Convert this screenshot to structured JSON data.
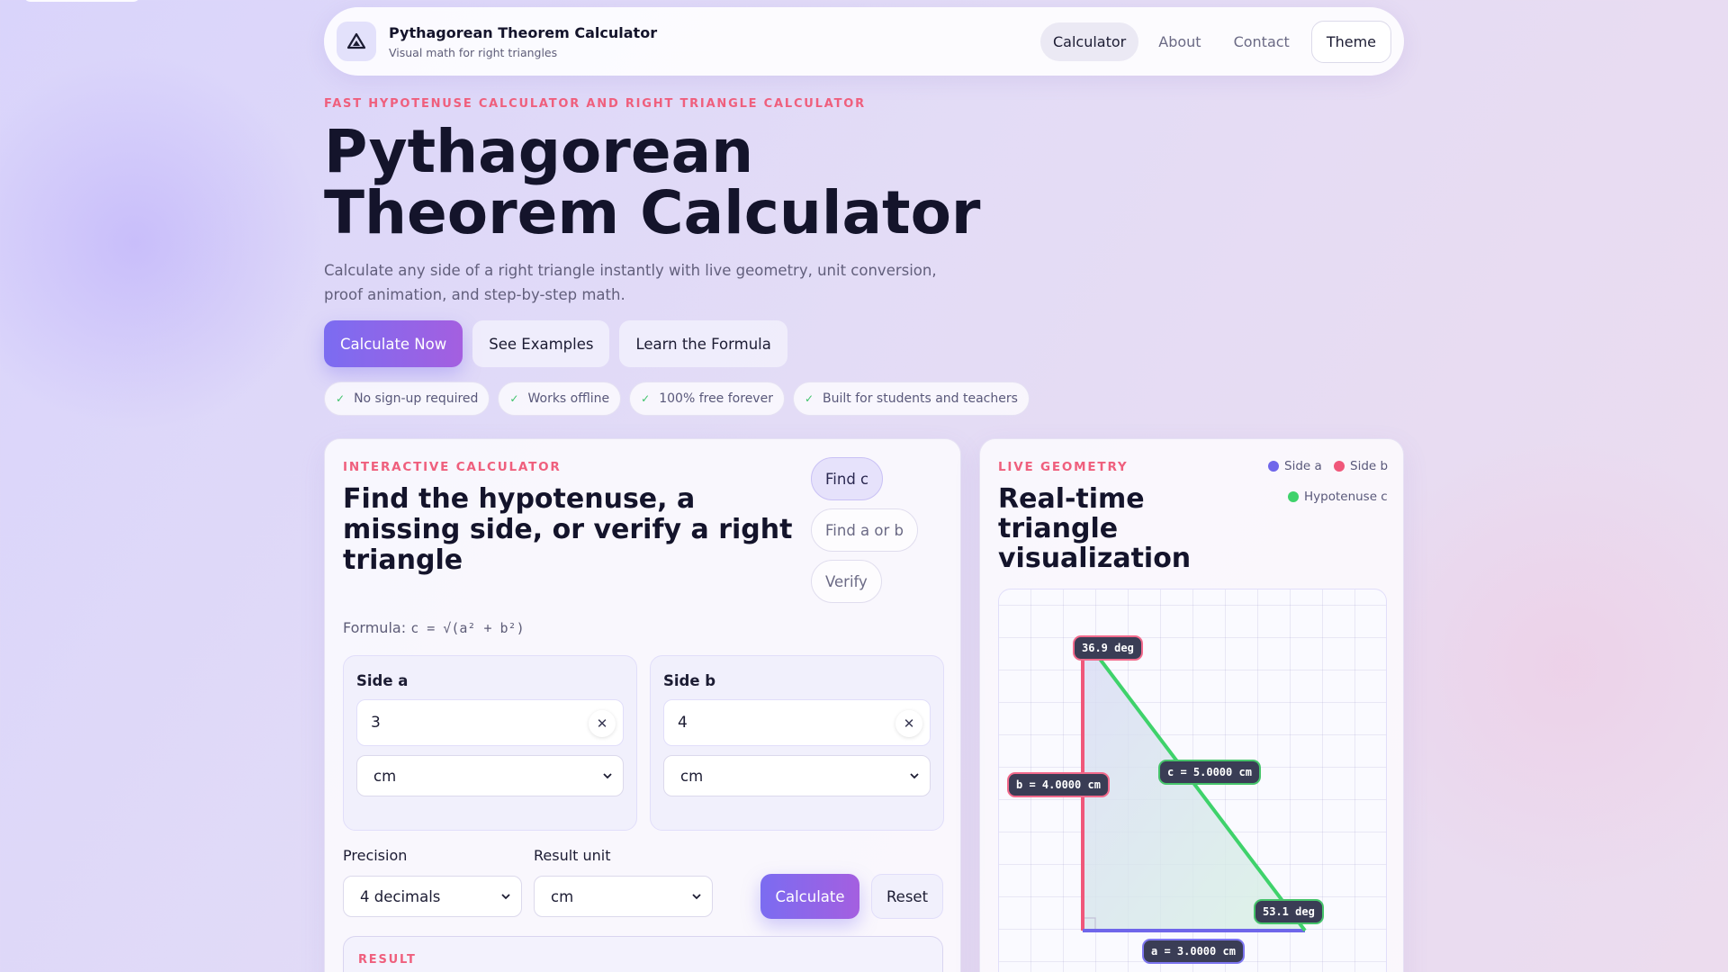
{
  "nav": {
    "brand_title": "Pythagorean Theorem Calculator",
    "brand_subtitle": "Visual math for right triangles",
    "links": [
      "Calculator",
      "About",
      "Contact"
    ],
    "theme_label": "Theme"
  },
  "hero": {
    "eyebrow": "FAST HYPOTENUSE CALCULATOR AND RIGHT TRIANGLE CALCULATOR",
    "title": "Pythagorean Theorem Calculator",
    "description": "Calculate any side of a right triangle instantly with live geometry, unit conversion, proof animation, and step-by-step math.",
    "cta_primary": "Calculate Now",
    "cta_examples": "See Examples",
    "cta_formula": "Learn the Formula",
    "chips": [
      "No sign-up required",
      "Works offline",
      "100% free forever",
      "Built for students and teachers"
    ]
  },
  "calculator": {
    "eyebrow": "INTERACTIVE CALCULATOR",
    "title": "Find the hypotenuse, a missing side, or verify a right triangle",
    "modes": [
      "Find c",
      "Find a or b",
      "Verify"
    ],
    "formula_label": "Formula:",
    "formula": "c = √(a² + b²)",
    "side_a": {
      "label": "Side a",
      "value": "3",
      "unit": "cm"
    },
    "side_b": {
      "label": "Side b",
      "value": "4",
      "unit": "cm"
    },
    "precision_label": "Precision",
    "precision_value": "4 decimals",
    "result_unit_label": "Result unit",
    "result_unit_value": "cm",
    "calculate_label": "Calculate",
    "reset_label": "Reset",
    "result_label": "RESULT"
  },
  "geometry": {
    "eyebrow": "LIVE GEOMETRY",
    "title": "Real-time triangle visualization",
    "legend": [
      "Side a",
      "Side b",
      "Hypotenuse c"
    ],
    "colors": {
      "side_a": "#6f66ea",
      "side_b": "#f0577a",
      "hypotenuse": "#3fd26b"
    },
    "tags": {
      "angle_top": "36.9 deg",
      "angle_bottom": "53.1 deg",
      "side_b": "b = 4.0000 cm",
      "side_c": "c = 5.0000 cm",
      "side_a": "a = 3.0000 cm"
    }
  }
}
